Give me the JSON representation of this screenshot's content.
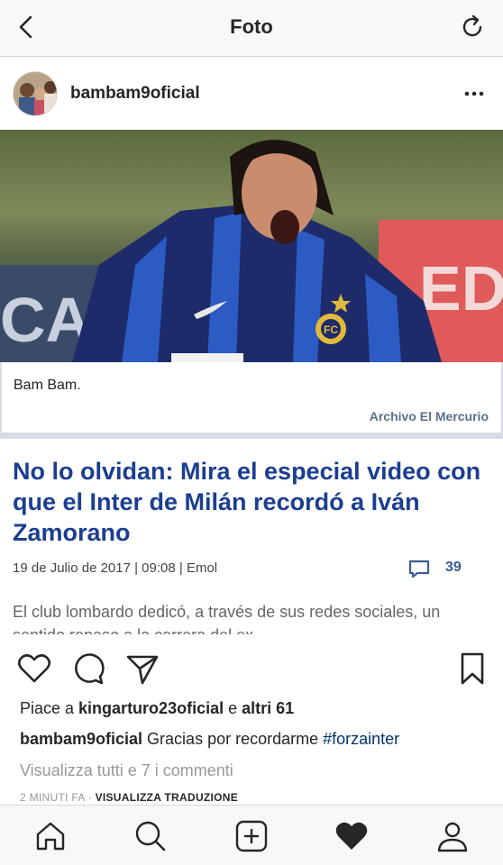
{
  "topbar": {
    "title": "Foto"
  },
  "post": {
    "username": "bambam9oficial",
    "image": {
      "photo_caption": "Bam Bam.",
      "photo_credit": "Archivo El Mercurio",
      "headline": "No lo olvidan: Mira el especial video con que el Inter de Milán recordó a Iván Zamorano",
      "meta": "19 de Julio de 2017 | 09:08 | Emol",
      "comment_count": "39",
      "lead": "El club lombardo dedicó, a través de sus redes sociales, un sentido repaso a la carrera del ex"
    },
    "likes": {
      "prefix": "Piace a ",
      "user": "kingarturo23oficial",
      "middle": " e ",
      "others": "altri 61"
    },
    "caption": {
      "user": "bambam9oficial",
      "text": " Gracias por recordarme ",
      "hashtag": "#forzainter"
    },
    "view_comments": "Visualizza tutti e 7 i commenti",
    "time": "2 MINUTI FA",
    "separator": " · ",
    "translate": "VISUALIZZA TRADUZIONE"
  },
  "colors": {
    "headline": "#1b3e91",
    "credit": "#5b6f8e",
    "hashtag": "#003569",
    "muted": "#999999"
  }
}
